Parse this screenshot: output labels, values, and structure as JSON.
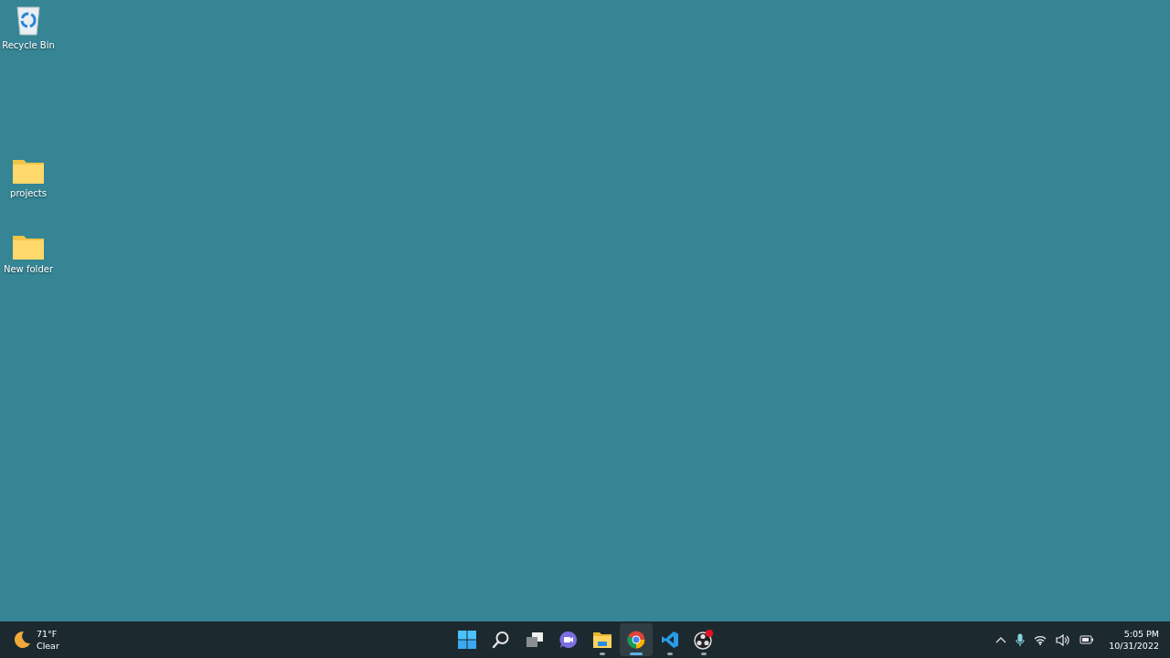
{
  "desktop_icons": [
    {
      "kind": "recycle-bin",
      "label": "Recycle Bin"
    },
    {
      "kind": "folder",
      "label": "projects"
    },
    {
      "kind": "folder",
      "label": "New folder"
    }
  ],
  "taskbar": {
    "weather": {
      "temperature": "71°F",
      "condition": "Clear"
    },
    "apps": [
      {
        "kind": "start",
        "running": false,
        "selected": false
      },
      {
        "kind": "search",
        "running": false,
        "selected": false
      },
      {
        "kind": "task-view",
        "running": false,
        "selected": false
      },
      {
        "kind": "chat",
        "running": false,
        "selected": false
      },
      {
        "kind": "explorer",
        "running": true,
        "selected": false
      },
      {
        "kind": "chrome",
        "running": true,
        "selected": true
      },
      {
        "kind": "vscode",
        "running": true,
        "selected": false
      },
      {
        "kind": "obs",
        "running": true,
        "selected": false
      }
    ],
    "tray": {
      "time": "5:05 PM",
      "date": "10/31/2022"
    }
  }
}
